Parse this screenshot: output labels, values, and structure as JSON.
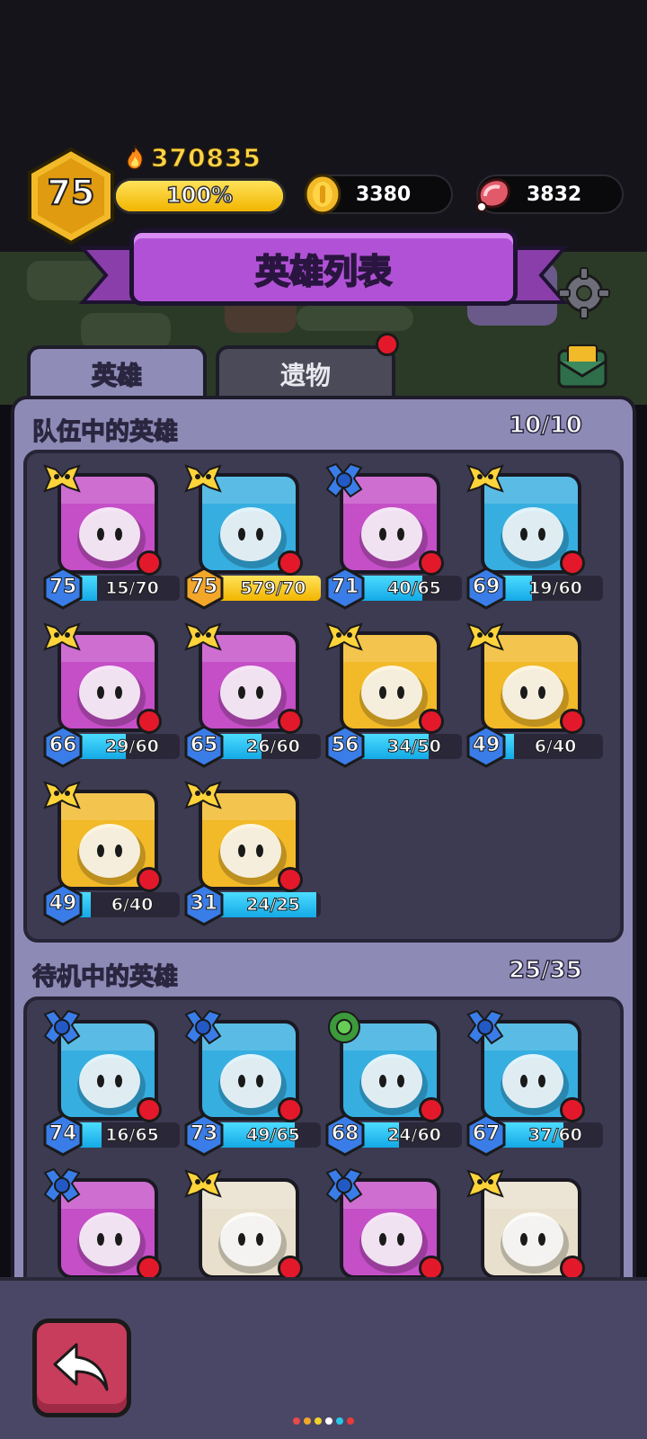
{
  "hud": {
    "player_level": "75",
    "power": "370835",
    "xp_label": "100%",
    "xp_fraction": 1.0,
    "gold": "3380",
    "meat": "3832",
    "icons": [
      "flame-icon",
      "gold-coin-icon",
      "meat-icon"
    ]
  },
  "header": {
    "title": "英雄列表",
    "right_icons": [
      "gear-icon",
      "mail-icon"
    ]
  },
  "tabs": [
    {
      "label": "英雄",
      "active": true
    },
    {
      "label": "遗物",
      "active": false,
      "notification": true
    }
  ],
  "team": {
    "title": "队伍中的英雄",
    "count": "10/10",
    "heroes": [
      {
        "level": "75",
        "progress": "15/70",
        "fill": 0.21,
        "rank": "gold",
        "bg": "#c44fc7",
        "icon": "knight-hero-icon",
        "bar": "blue"
      },
      {
        "level": "75",
        "progress": "579/70",
        "fill": 1.0,
        "rank": "gold",
        "bg": "#36aee0",
        "icon": "leaf-hero-icon",
        "bar": "gold"
      },
      {
        "level": "71",
        "progress": "40/65",
        "fill": 0.62,
        "rank": "blue",
        "bg": "#c44fc7",
        "icon": "tree-hero-icon",
        "bar": "blue"
      },
      {
        "level": "69",
        "progress": "19/60",
        "fill": 0.32,
        "rank": "gold",
        "bg": "#36aee0",
        "icon": "horned-hero-icon",
        "bar": "blue"
      },
      {
        "level": "66",
        "progress": "29/60",
        "fill": 0.48,
        "rank": "gold",
        "bg": "#c44fc7",
        "icon": "archer-hero-icon",
        "bar": "blue"
      },
      {
        "level": "65",
        "progress": "26/60",
        "fill": 0.43,
        "rank": "gold",
        "bg": "#c44fc7",
        "icon": "pirate-hero-icon",
        "bar": "blue"
      },
      {
        "level": "56",
        "progress": "34/50",
        "fill": 0.68,
        "rank": "gold",
        "bg": "#f2b928",
        "icon": "fire-hero-icon",
        "bar": "blue"
      },
      {
        "level": "49",
        "progress": "6/40",
        "fill": 0.15,
        "rank": "gold",
        "bg": "#f2b928",
        "icon": "samurai-hero-icon",
        "bar": "blue"
      },
      {
        "level": "49",
        "progress": "6/40",
        "fill": 0.15,
        "rank": "gold",
        "bg": "#f2b928",
        "icon": "princess-hero-icon",
        "bar": "blue"
      },
      {
        "level": "31",
        "progress": "24/25",
        "fill": 0.96,
        "rank": "gold",
        "bg": "#f2b928",
        "icon": "spiral-mask-hero-icon",
        "bar": "blue"
      }
    ]
  },
  "standby": {
    "title": "待机中的英雄",
    "count": "25/35",
    "heroes": [
      {
        "level": "74",
        "progress": "16/65",
        "fill": 0.25,
        "rank": "blue",
        "bg": "#36aee0",
        "icon": "snowman-hero-icon",
        "bar": "blue"
      },
      {
        "level": "73",
        "progress": "49/65",
        "fill": 0.75,
        "rank": "blue",
        "bg": "#36aee0",
        "icon": "spiked-helmet-hero-icon",
        "bar": "blue"
      },
      {
        "level": "68",
        "progress": "24/60",
        "fill": 0.4,
        "rank": "green",
        "bg": "#36aee0",
        "icon": "robot-hero-icon",
        "bar": "blue"
      },
      {
        "level": "67",
        "progress": "37/60",
        "fill": 0.62,
        "rank": "blue",
        "bg": "#36aee0",
        "icon": "storm-cloud-hero-icon",
        "bar": "blue"
      },
      {
        "level": "",
        "progress": "",
        "fill": 0.3,
        "rank": "blue",
        "bg": "#c44fc7",
        "icon": "dino-hero-icon",
        "bar": "blue"
      },
      {
        "level": "",
        "progress": "",
        "fill": 0.3,
        "rank": "gold",
        "bg": "#e8e0cc",
        "icon": "bell-hero-icon",
        "bar": "blue"
      },
      {
        "level": "",
        "progress": "",
        "fill": 0.3,
        "rank": "blue",
        "bg": "#c44fc7",
        "icon": "bunny-hero-icon",
        "bar": "blue"
      },
      {
        "level": "",
        "progress": "",
        "fill": 0.3,
        "rank": "gold",
        "bg": "#e8e0cc",
        "icon": "bow-hero-icon",
        "bar": "blue"
      }
    ]
  },
  "footer": {
    "back_icon": "back-arrow-icon",
    "page_dots": [
      "#e84a4a",
      "#f2a62a",
      "#f2d22a",
      "#ffffff",
      "#2ac7e8",
      "#e83a3a"
    ]
  }
}
